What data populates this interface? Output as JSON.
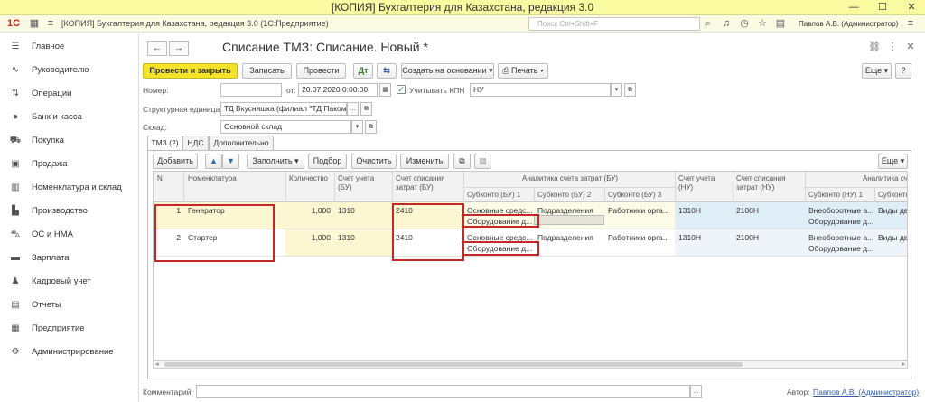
{
  "titlebar": {
    "title": "[КОПИЯ] Бухгалтерия для Казахстана, редакция 3.0"
  },
  "appbar": {
    "logo": "1С",
    "app_title": "[КОПИЯ] Бухгалтерия для Казахстана, редакция 3.0  (1С:Предприятие)",
    "search_placeholder": "Поиск Ctrl+Shift+F",
    "user": "Павлов А.В. (Администратор)"
  },
  "sidebar": {
    "items": [
      {
        "label": "Главное",
        "icon": "menu-icon"
      },
      {
        "label": "Руководителю",
        "icon": "chart-line-icon"
      },
      {
        "label": "Операции",
        "icon": "operations-icon"
      },
      {
        "label": "Банк и касса",
        "icon": "coins-icon"
      },
      {
        "label": "Покупка",
        "icon": "cart-icon"
      },
      {
        "label": "Продажа",
        "icon": "bag-icon"
      },
      {
        "label": "Номенклатура и склад",
        "icon": "warehouse-icon"
      },
      {
        "label": "Производство",
        "icon": "factory-icon"
      },
      {
        "label": "ОС и НМА",
        "icon": "truck-icon"
      },
      {
        "label": "Зарплата",
        "icon": "money-icon"
      },
      {
        "label": "Кадровый учет",
        "icon": "people-icon"
      },
      {
        "label": "Отчеты",
        "icon": "report-icon"
      },
      {
        "label": "Предприятие",
        "icon": "building-icon"
      },
      {
        "label": "Администрирование",
        "icon": "gear-icon"
      }
    ]
  },
  "document": {
    "title": "Списание ТМЗ: Списание. Новый *",
    "toolbar": {
      "post_close": "Провести и закрыть",
      "save": "Записать",
      "post": "Провести",
      "create_based": "Создать на основании",
      "print": "Печать",
      "more": "Еще",
      "help": "?"
    },
    "fields": {
      "number_label": "Номер:",
      "number_value": "",
      "date_label": "от:",
      "date_value": "20.07.2020  0:00:00",
      "kpn_label": "Учитывать КПН",
      "kpn_checked": "✓",
      "kpn_value": "НУ",
      "unit_label": "Структурная единица:",
      "unit_value": "ТД Вкусняшка (филиал \"ТД Пакомк",
      "warehouse_label": "Склад:",
      "warehouse_value": "Основной склад"
    },
    "tabs": [
      "ТМЗ (2)",
      "НДС",
      "Дополнительно"
    ],
    "table_toolbar": {
      "add": "Добавить",
      "fill": "Заполнить",
      "select": "Подбор",
      "clear": "Очистить",
      "change": "Изменить",
      "more": "Еще"
    },
    "table": {
      "headers": {
        "n": "N",
        "item": "Номенклатура",
        "qty": "Количество",
        "account": [
          "Счет учета",
          "(БУ)"
        ],
        "writeoff": [
          "Счет списания",
          "затрат (БУ)"
        ],
        "analytics_bu": "Аналитика счета затрат (БУ)",
        "sub1": "Субконто (БУ) 1",
        "sub2": "Субконто (БУ) 2",
        "sub3": "Субконто (БУ) 3",
        "account_nu": [
          "Счет учета",
          "(НУ)"
        ],
        "writeoff_nu": [
          "Счет списания",
          "затрат (НУ)"
        ],
        "analytics_nu": "Аналитика сче",
        "sub_nu1": "Субконто (НУ) 1",
        "sub_nu2": "Субконто"
      },
      "rows": [
        {
          "n": "1",
          "item": "Генератор",
          "qty": "1,000",
          "account": "1310",
          "writeoff": "2410",
          "sub1": "Основные средс...",
          "sub1b": "Оборудование д...",
          "sub2": "Подразделения",
          "sub3": "Работники орга...",
          "account_nu": "1310Н",
          "writeoff_nu": "2100Н",
          "sub_nu1": "Внеоборотные а...",
          "sub_nu1b": "Оборудование д...",
          "sub_nu2": "Виды дви"
        },
        {
          "n": "2",
          "item": "Стартер",
          "qty": "1,000",
          "account": "1310",
          "writeoff": "2410",
          "sub1": "Основные средс...",
          "sub1b": "Оборудование д...",
          "sub2": "Подразделения",
          "sub3": "Работники орга...",
          "account_nu": "1310Н",
          "writeoff_nu": "2100Н",
          "sub_nu1": "Внеоборотные а...",
          "sub_nu1b": "Оборудование д...",
          "sub_nu2": "Виды дви"
        }
      ]
    },
    "footer": {
      "comment_label": "Комментарий:",
      "comment_value": "",
      "author_label": "Автор:",
      "author_value": "Павлов А.В. (Администратор)"
    }
  }
}
